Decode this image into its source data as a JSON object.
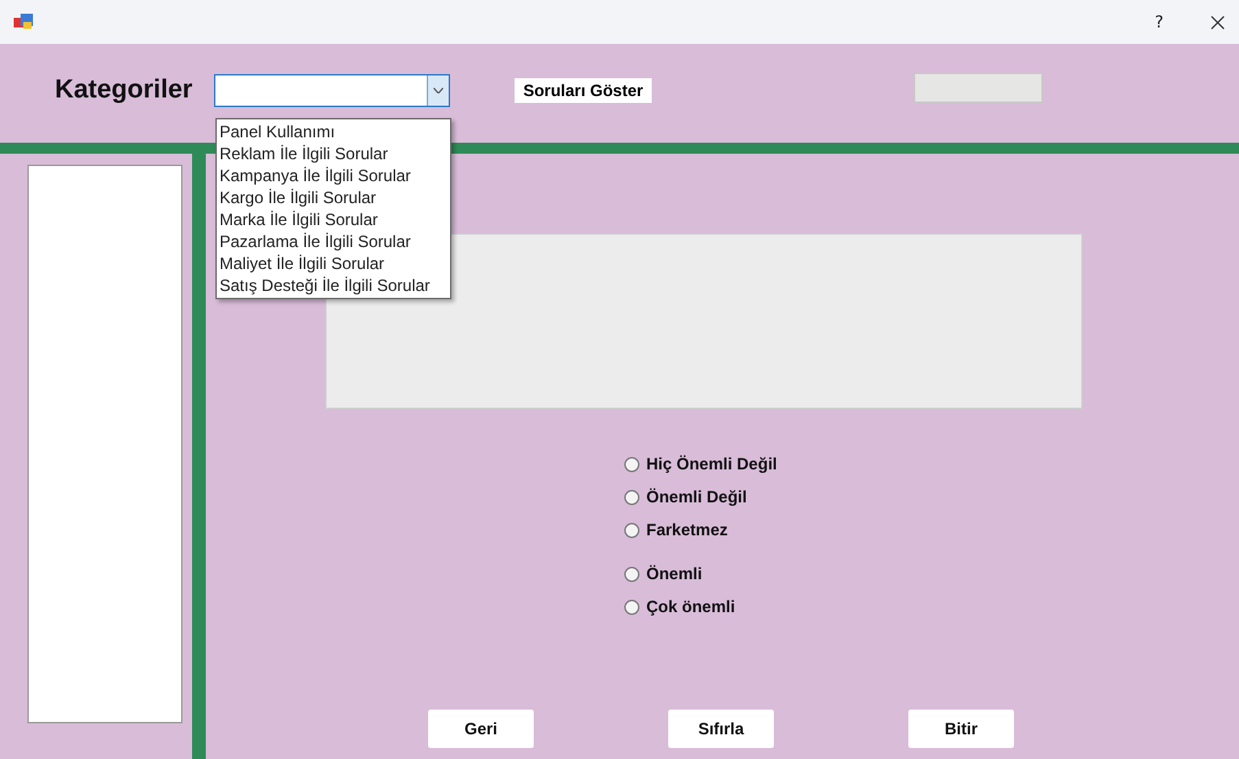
{
  "window": {
    "help": "?"
  },
  "category_label": "Kategoriler",
  "category_combo": {
    "expanded": true,
    "options": [
      {
        "label": "Panel Kullanımı",
        "selected": false
      },
      {
        "label": "Reklam İle İlgili Sorular",
        "selected": false
      },
      {
        "label": "Kampanya İle İlgili Sorular",
        "selected": false
      },
      {
        "label": "Kargo İle İlgili Sorular",
        "selected": false
      },
      {
        "label": "Marka İle İlgili Sorular",
        "selected": false
      },
      {
        "label": "Pazarlama İle İlgili Sorular",
        "selected": false
      },
      {
        "label": "Maliyet İle İlgili Sorular",
        "selected": false
      },
      {
        "label": "Satış Desteği İle İlgili Sorular",
        "selected": false
      }
    ]
  },
  "show_button": "Soruları Göster",
  "counter_field": {
    "disabled": true
  },
  "answers": [
    {
      "label": "Hiç Önemli Değil",
      "selected": false
    },
    {
      "label": "Önemli Değil",
      "selected": false
    },
    {
      "label": "Farketmez",
      "selected": false
    },
    {
      "label": "Önemli",
      "selected": false
    },
    {
      "label": "Çok önemli",
      "selected": false
    }
  ],
  "buttons": [
    "Geri",
    "Sıfırla",
    "Bitir"
  ]
}
